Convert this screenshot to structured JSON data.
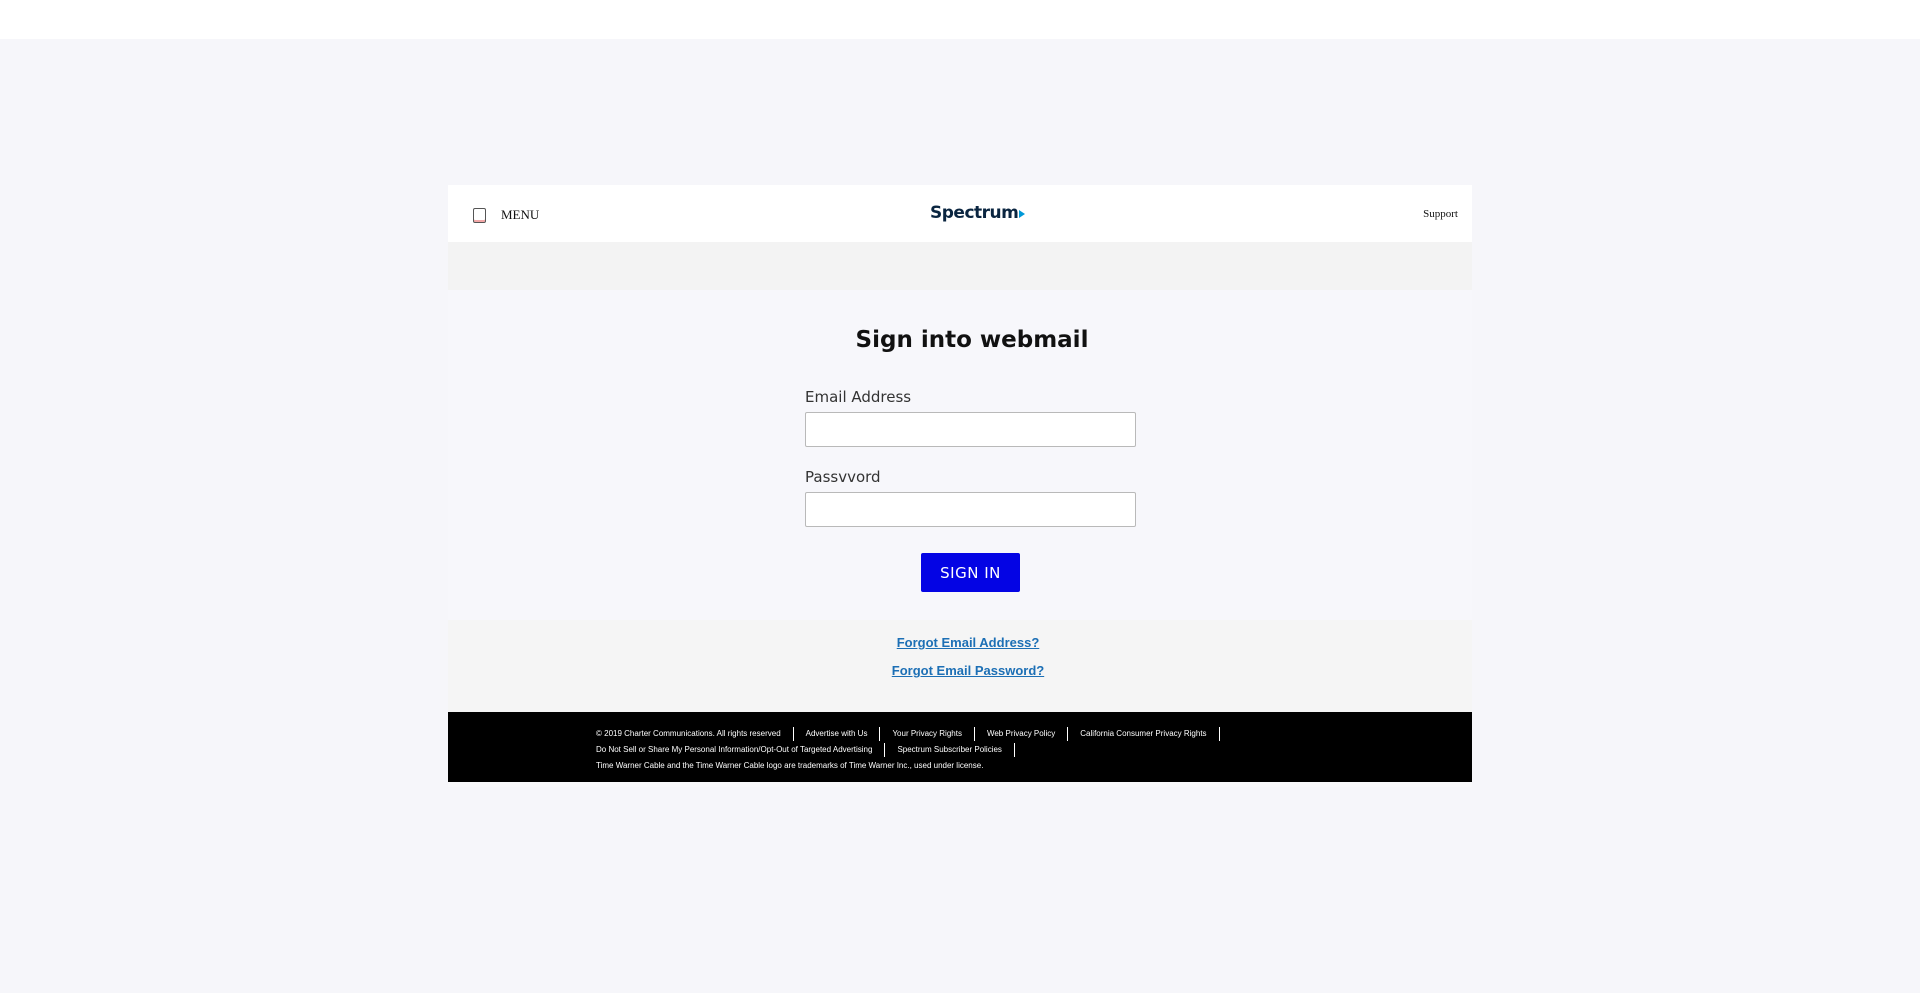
{
  "header": {
    "menu_label": "MENU",
    "logo_text": "Spectrum",
    "support_label": "Support"
  },
  "form": {
    "title": "Sign into webmail",
    "email_label": "Email Address",
    "email_value": "",
    "password_label": "Passvvord",
    "password_value": "",
    "signin_label": "SIGN IN"
  },
  "links": {
    "forgot_email": "Forgot Email Address?",
    "forgot_password": "Forgot Email Password?"
  },
  "footer": {
    "row1": [
      "© 2019 Charter Communications. All rights reserved",
      "Advertise with Us",
      "Your Privacy Rights",
      "Web Privacy Policy",
      "California Consumer Privacy Rights"
    ],
    "row2": [
      "Do Not Sell or Share My Personal Information/Opt-Out of Targeted Advertising",
      "Spectrum Subscriber Policies"
    ],
    "row3": [
      "Time Warner Cable and the Time Warner Cable logo are trademarks of Time Warner Inc., used under license."
    ]
  },
  "colors": {
    "signin_button": "#0404e4",
    "link": "#1c6fb5",
    "footer_bg": "#000000",
    "logo_accent": "#0099d8"
  }
}
